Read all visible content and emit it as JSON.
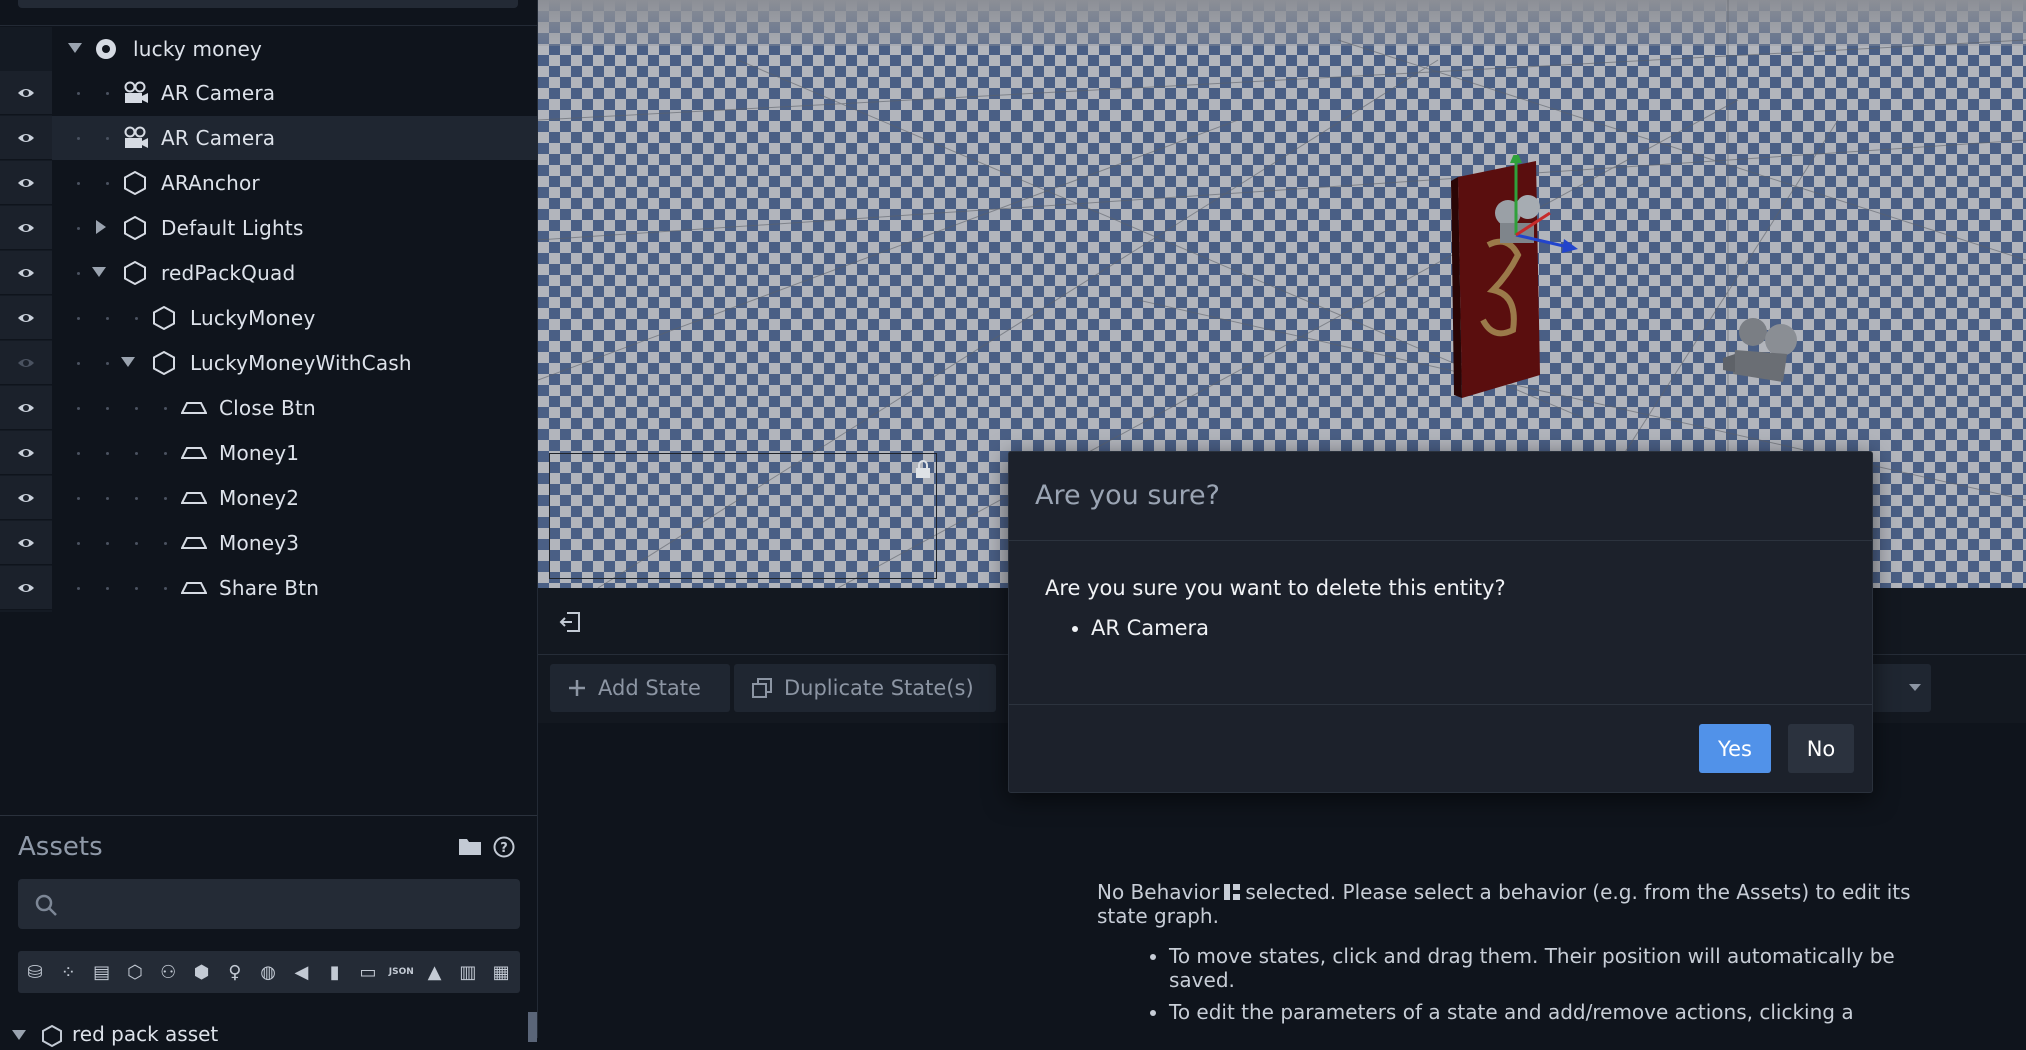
{
  "hierarchy": {
    "root_label": "lucky money",
    "items": [
      {
        "label": "AR Camera",
        "icon": "camera-icon",
        "depth": 1,
        "toggle": "none",
        "visible": true,
        "selected": false
      },
      {
        "label": "AR Camera",
        "icon": "camera-icon",
        "depth": 1,
        "toggle": "none",
        "visible": true,
        "selected": true
      },
      {
        "label": "ARAnchor",
        "icon": "entity-icon",
        "depth": 1,
        "toggle": "none",
        "visible": true,
        "selected": false
      },
      {
        "label": "Default Lights",
        "icon": "entity-icon",
        "depth": 1,
        "toggle": "collapsed",
        "visible": true,
        "selected": false
      },
      {
        "label": "redPackQuad",
        "icon": "entity-icon",
        "depth": 1,
        "toggle": "expanded",
        "visible": true,
        "selected": false
      },
      {
        "label": "LuckyMoney",
        "icon": "entity-icon",
        "depth": 2,
        "toggle": "none",
        "visible": true,
        "selected": false
      },
      {
        "label": "LuckyMoneyWithCash",
        "icon": "entity-icon",
        "depth": 2,
        "toggle": "expanded",
        "visible": false,
        "selected": false
      },
      {
        "label": "Close Btn",
        "icon": "plane-icon",
        "depth": 3,
        "toggle": "none",
        "visible": true,
        "selected": false
      },
      {
        "label": "Money1",
        "icon": "plane-icon",
        "depth": 3,
        "toggle": "none",
        "visible": true,
        "selected": false
      },
      {
        "label": "Money2",
        "icon": "plane-icon",
        "depth": 3,
        "toggle": "none",
        "visible": true,
        "selected": false
      },
      {
        "label": "Money3",
        "icon": "plane-icon",
        "depth": 3,
        "toggle": "none",
        "visible": true,
        "selected": false
      },
      {
        "label": "Share Btn",
        "icon": "plane-icon",
        "depth": 3,
        "toggle": "none",
        "visible": true,
        "selected": false
      }
    ]
  },
  "assets": {
    "title": "Assets",
    "search_value": "",
    "filters": [
      "models-icon",
      "particles-icon",
      "video-icon",
      "entity-icon",
      "characters-icon",
      "box-icon",
      "person-icon",
      "environment-icon",
      "audio-icon",
      "script-icon",
      "chat-icon",
      "json-icon",
      "image-icon",
      "behavior-icon",
      "texture-icon"
    ],
    "json_label": "JSON",
    "tree_item": "red pack asset"
  },
  "editor": {
    "add_state_label": "Add State",
    "duplicate_state_label": "Duplicate State(s)",
    "help_intro_before": "No Behavior",
    "help_intro_after": "selected. Please select a behavior (e.g. from the Assets) to edit its state graph.",
    "help_bullets": [
      "To move states, click and drag them. Their position will automatically be saved.",
      "To edit the parameters of a state and add/remove actions, clicking a"
    ]
  },
  "dialog": {
    "title": "Are you sure?",
    "message": "Are you sure you want to delete this entity?",
    "entities": [
      "AR Camera"
    ],
    "yes_label": "Yes",
    "no_label": "No"
  },
  "colors": {
    "primary_button": "#5192e9",
    "checker_dark": "#4a5f85",
    "checker_light": "#b2b5bc",
    "panel_bg": "#0f141c"
  }
}
